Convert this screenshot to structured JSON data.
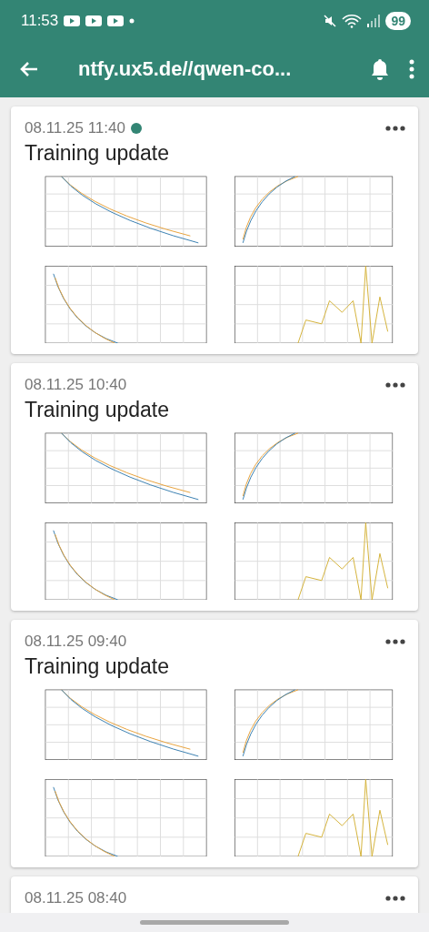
{
  "status_bar": {
    "time": "11:53",
    "battery": "99"
  },
  "app_bar": {
    "title": "ntfy.ux5.de//qwen-co..."
  },
  "notifications": [
    {
      "time": "08.11.25 11:40",
      "unread": true,
      "title": "Training update"
    },
    {
      "time": "08.11.25 10:40",
      "unread": false,
      "title": "Training update"
    },
    {
      "time": "08.11.25 09:40",
      "unread": false,
      "title": "Training update"
    },
    {
      "time": "08.11.25 08:40",
      "unread": false
    }
  ]
}
